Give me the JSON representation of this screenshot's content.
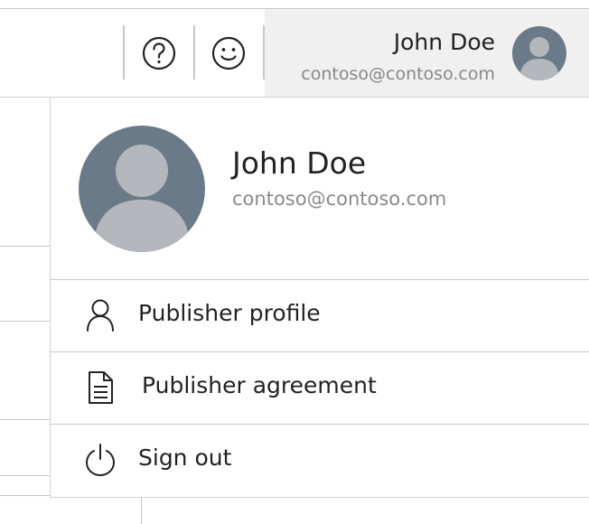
{
  "header": {
    "help_icon": "question-circle-icon",
    "feedback_icon": "smiley-icon",
    "account": {
      "name": "John Doe",
      "email": "contoso@contoso.com",
      "avatar_icon": "user-avatar-icon"
    }
  },
  "panel": {
    "name": "John Doe",
    "email": "contoso@contoso.com",
    "avatar_icon": "user-avatar-icon",
    "menu": [
      {
        "label": "Publisher profile",
        "icon": "person-icon"
      },
      {
        "label": "Publisher agreement",
        "icon": "document-icon"
      },
      {
        "label": "Sign out",
        "icon": "power-icon"
      }
    ]
  },
  "colors": {
    "avatar_bg": "#6b7a89",
    "avatar_figure": "#b4b8bc",
    "account_area_bg": "#f0f0f0",
    "divider": "#c8c8c8"
  }
}
